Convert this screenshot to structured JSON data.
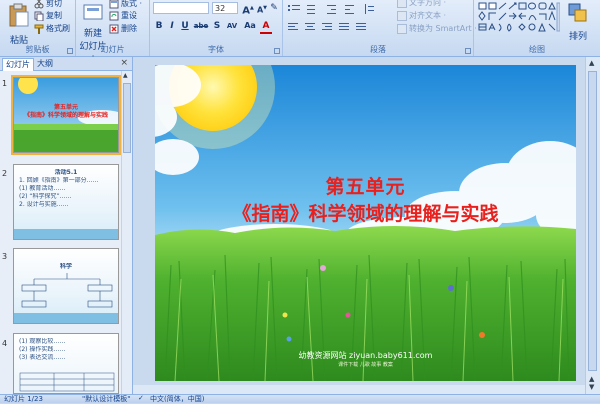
{
  "ribbon": {
    "clipboard": {
      "paste_label": "粘贴",
      "cut_label": "剪切",
      "copy_label": "复制",
      "format_painter_label": "格式刷",
      "group_label": "剪贴板"
    },
    "slides": {
      "new_slide_label_1": "新建",
      "new_slide_label_2": "幻灯片 ·",
      "layout_label": "版式 ·",
      "reset_label": "重设",
      "delete_label": "删除",
      "group_label": "幻灯片"
    },
    "font": {
      "font_name": "",
      "font_size": "32",
      "bold": "B",
      "italic": "I",
      "underline": "U",
      "strike": "abe",
      "shadow": "S",
      "spacing": "AV",
      "case": "Aa",
      "color": "A",
      "group_label": "字体"
    },
    "paragraph": {
      "text_direction_label": "文字方向 ·",
      "align_text_label": "对齐文本 ·",
      "smartart_label": "转换为 SmartArt ·",
      "group_label": "段落"
    },
    "drawing": {
      "arrange_label": "排列",
      "group_label": "绘图"
    }
  },
  "left_pane": {
    "tab_slides": "幻灯片",
    "tab_outline": "大纲",
    "close": "×",
    "thumbs": [
      {
        "num": "1",
        "lines": [
          "第五单元",
          "《指南》科学领域的理解与实践"
        ]
      },
      {
        "num": "2",
        "lines": [
          "活动5.1",
          "1. 回顾《指南》第一部分……",
          "(1) 教育活动……",
          "(2) “科学探究”……",
          "2. 设计与实施……"
        ]
      },
      {
        "num": "3",
        "lines": [
          "科学"
        ]
      },
      {
        "num": "4",
        "lines": [
          "(1) 观察比较……",
          "(2) 操作实践……",
          "(3) 表达交流……"
        ]
      }
    ]
  },
  "slide": {
    "title_line1": "第五单元",
    "title_line2": "《指南》科学领域的理解与实践",
    "footer": "幼教资源网站 ziyuan.baby611.com",
    "footer_small": "课件下载  儿歌  故事  教案"
  },
  "status": {
    "slide_info": "幻灯片 1/23",
    "theme": "\"默认设计模板\"",
    "language": "中文(简体，中国)"
  },
  "colors": {
    "ribbon_bg": "#dbe7f6",
    "title_red": "#e8211e",
    "selected_outline": "#f0b341"
  }
}
